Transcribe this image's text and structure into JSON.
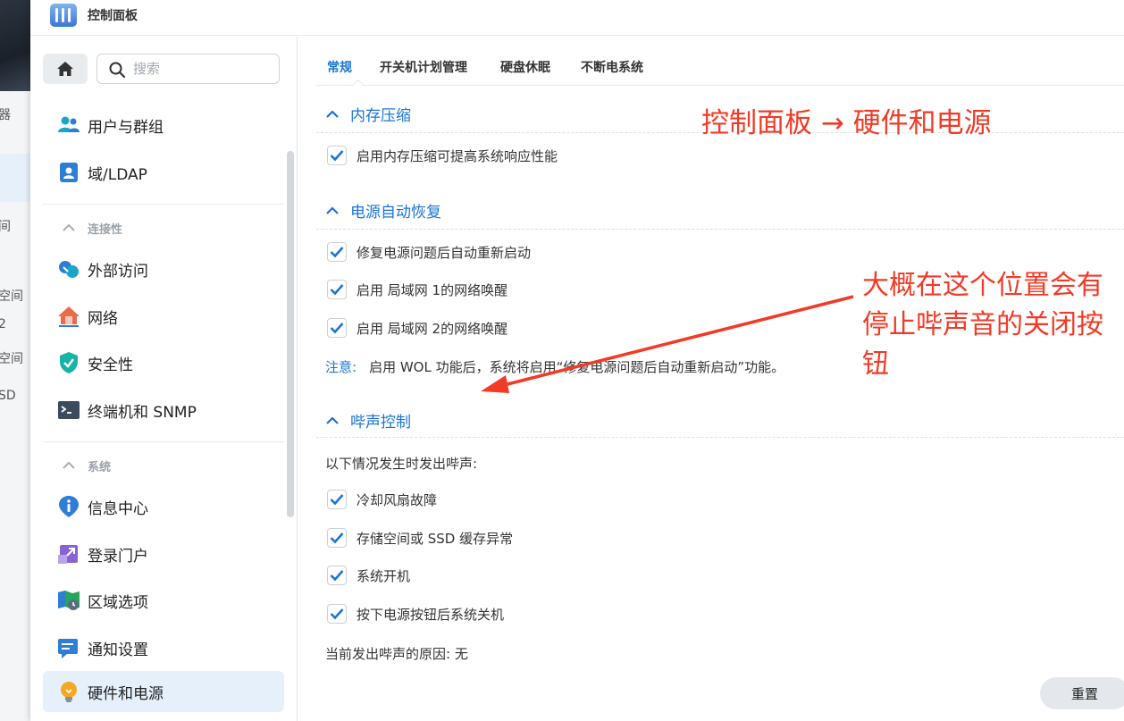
{
  "background": {
    "texts": [
      "器",
      "间",
      "空间",
      "2",
      "空间",
      "SD"
    ]
  },
  "window": {
    "title": "控制面板"
  },
  "sidebar": {
    "search_placeholder": "搜索",
    "items": [
      {
        "label": "用户与群组",
        "icon": "users-icon"
      },
      {
        "label": "域/LDAP",
        "icon": "domain-icon"
      },
      {
        "label": "连接性",
        "icon": "chevron-up-icon",
        "section": true
      },
      {
        "label": "外部访问",
        "icon": "external-access-icon"
      },
      {
        "label": "网络",
        "icon": "network-home-icon"
      },
      {
        "label": "安全性",
        "icon": "shield-icon"
      },
      {
        "label": "终端机和 SNMP",
        "icon": "terminal-icon"
      },
      {
        "label": "系统",
        "icon": "chevron-up-icon",
        "section": true
      },
      {
        "label": "信息中心",
        "icon": "info-icon"
      },
      {
        "label": "登录门户",
        "icon": "login-portal-icon"
      },
      {
        "label": "区域选项",
        "icon": "region-icon"
      },
      {
        "label": "通知设置",
        "icon": "notification-icon"
      },
      {
        "label": "硬件和电源",
        "icon": "bulb-icon",
        "active": true
      }
    ]
  },
  "tabs": [
    "常规",
    "开关机计划管理",
    "硬盘休眠",
    "不断电系统"
  ],
  "sections": {
    "memory": {
      "title": "内存压缩",
      "options": [
        "启用内存压缩可提高系统响应性能"
      ]
    },
    "power_recovery": {
      "title": "电源自动恢复",
      "options": [
        "修复电源问题后自动重新启动",
        "启用 局域网 1的网络唤醒",
        "启用 局域网 2的网络唤醒"
      ],
      "note_label": "注意:",
      "note_text": "启用 WOL 功能后，系统将启用“修复电源问题后自动重新启动”功能。"
    },
    "beep": {
      "title": "哔声控制",
      "intro": "以下情况发生时发出哔声:",
      "options": [
        "冷却风扇故障",
        "存储空间或 SSD 缓存异常",
        "系统开机",
        "按下电源按钮后系统关机"
      ],
      "current_reason": "当前发出哔声的原因:  无"
    }
  },
  "footer": {
    "reset_label": "重置"
  },
  "annotations": {
    "title": "控制面板 → 硬件和电源",
    "hint": "大概在这个位置会有停止哔声音的关闭按钮",
    "color": "#f23a26"
  },
  "colors": {
    "accent": "#1a74d6",
    "active_bg": "#e6f0fa"
  }
}
